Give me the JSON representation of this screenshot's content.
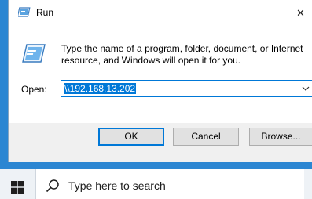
{
  "dialog": {
    "title": "Run",
    "description": "Type the name of a program, folder, document, or Internet resource, and Windows will open it for you.",
    "open_label": "Open:",
    "open_value": "\\\\192.168.13.202",
    "buttons": {
      "ok": "OK",
      "cancel": "Cancel",
      "browse": "Browse..."
    }
  },
  "taskbar": {
    "search_placeholder": "Type here to search"
  },
  "icons": {
    "title": "run-icon",
    "close": "close-icon",
    "dropdown": "chevron-down-icon",
    "start": "windows-logo-icon",
    "search": "search-icon"
  },
  "colors": {
    "accent": "#0078d7",
    "desktop": "#2b86d2"
  }
}
